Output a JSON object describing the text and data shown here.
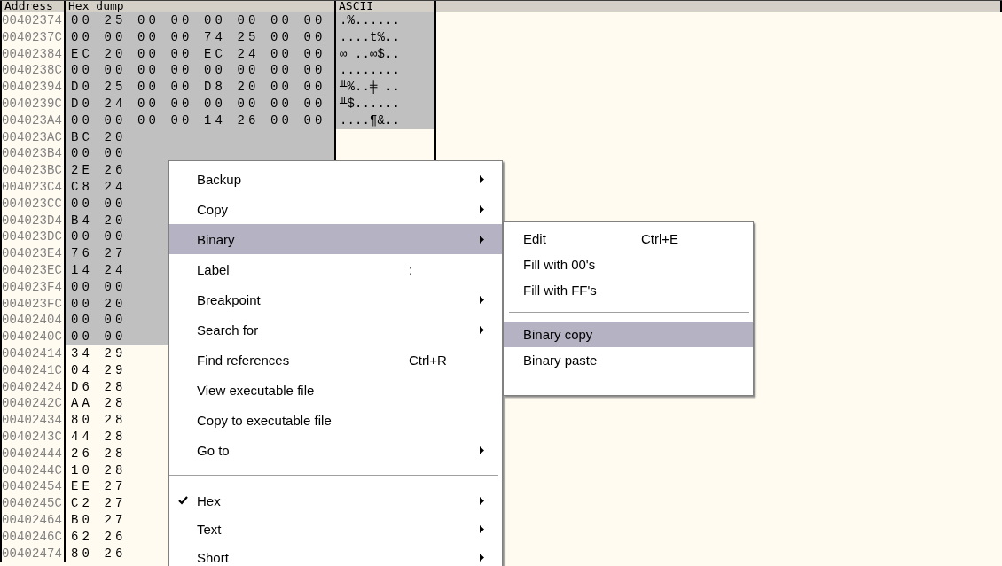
{
  "dump": {
    "columns": [
      "Address",
      "Hex dump",
      "ASCII"
    ],
    "rows": [
      {
        "address": "00402374",
        "hex": "00 25 00 00 00 00 00 00",
        "ascii": ".%......",
        "selected": true
      },
      {
        "address": "0040237C",
        "hex": "00 00 00 00 74 25 00 00",
        "ascii": "....t%..",
        "selected": true
      },
      {
        "address": "00402384",
        "hex": "EC 20 00 00 EC 24 00 00",
        "ascii": "∞ ..∞$..",
        "selected": true
      },
      {
        "address": "0040238C",
        "hex": "00 00 00 00 00 00 00 00",
        "ascii": "........",
        "selected": true
      },
      {
        "address": "00402394",
        "hex": "D0 25 00 00 D8 20 00 00",
        "ascii": "╨%..╪ ..",
        "selected": true
      },
      {
        "address": "0040239C",
        "hex": "D0 24 00 00 00 00 00 00",
        "ascii": "╨$......",
        "selected": true
      },
      {
        "address": "004023A4",
        "hex": "00 00 00 00 14 26 00 00",
        "ascii": "....¶&..",
        "selected": true
      },
      {
        "address": "004023AC",
        "hex": "BC 20",
        "selected": true
      },
      {
        "address": "004023B4",
        "hex": "00 00",
        "selected": true
      },
      {
        "address": "004023BC",
        "hex": "2E 26",
        "selected": true
      },
      {
        "address": "004023C4",
        "hex": "C8 24",
        "selected": true
      },
      {
        "address": "004023CC",
        "hex": "00 00",
        "selected": true
      },
      {
        "address": "004023D4",
        "hex": "B4 20",
        "selected": true
      },
      {
        "address": "004023DC",
        "hex": "00 00",
        "selected": true
      },
      {
        "address": "004023E4",
        "hex": "76 27",
        "selected": true
      },
      {
        "address": "004023EC",
        "hex": "14 24",
        "selected": true
      },
      {
        "address": "004023F4",
        "hex": "00 00",
        "selected": true
      },
      {
        "address": "004023FC",
        "hex": "00 20",
        "selected": true
      },
      {
        "address": "00402404",
        "hex": "00 00",
        "selected": true
      },
      {
        "address": "0040240C",
        "hex": "00 00",
        "selected": true
      },
      {
        "address": "00402414",
        "hex": "34 29",
        "selected": false
      },
      {
        "address": "0040241C",
        "hex": "04 29",
        "selected": false
      },
      {
        "address": "00402424",
        "hex": "D6 28",
        "selected": false
      },
      {
        "address": "0040242C",
        "hex": "AA 28",
        "selected": false
      },
      {
        "address": "00402434",
        "hex": "80 28",
        "selected": false
      },
      {
        "address": "0040243C",
        "hex": "44 28",
        "selected": false
      },
      {
        "address": "00402444",
        "hex": "26 28",
        "selected": false
      },
      {
        "address": "0040244C",
        "hex": "10 28",
        "selected": false
      },
      {
        "address": "00402454",
        "hex": "EE 27",
        "selected": false
      },
      {
        "address": "0040245C",
        "hex": "C2 27",
        "selected": false
      },
      {
        "address": "00402464",
        "hex": "B0 27",
        "selected": false
      },
      {
        "address": "0040246C",
        "hex": "62 26",
        "selected": false
      },
      {
        "address": "00402474",
        "hex": "80 26",
        "selected": false
      }
    ]
  },
  "context_menu": {
    "items": [
      {
        "kind": "item",
        "label": "Backup",
        "submenu": true,
        "selected": false
      },
      {
        "kind": "item",
        "label": "Copy",
        "submenu": true,
        "selected": false
      },
      {
        "kind": "item",
        "label": "Binary",
        "submenu": true,
        "selected": true
      },
      {
        "kind": "item",
        "label": "Label",
        "shortcut": ":",
        "selected": false
      },
      {
        "kind": "item",
        "label": "Breakpoint",
        "submenu": true,
        "selected": false
      },
      {
        "kind": "item",
        "label": "Search for",
        "submenu": true,
        "selected": false
      },
      {
        "kind": "item",
        "label": "Find references",
        "shortcut": "Ctrl+R",
        "selected": false
      },
      {
        "kind": "item",
        "label": "View executable file",
        "selected": false
      },
      {
        "kind": "item",
        "label": "Copy to executable file",
        "selected": false
      },
      {
        "kind": "item",
        "label": "Go to",
        "submenu": true,
        "selected": false
      },
      {
        "kind": "separator"
      },
      {
        "kind": "item",
        "label": "Hex",
        "submenu": true,
        "checked": true,
        "selected": false
      },
      {
        "kind": "item",
        "label": "Text",
        "submenu": true,
        "checked": false,
        "selected": false
      },
      {
        "kind": "item",
        "label": "Short",
        "submenu": true,
        "checked": false,
        "selected": false
      }
    ]
  },
  "submenu": {
    "items": [
      {
        "kind": "item",
        "label": "Edit",
        "shortcut": "Ctrl+E",
        "selected": false
      },
      {
        "kind": "item",
        "label": "Fill with 00's",
        "selected": false
      },
      {
        "kind": "item",
        "label": "Fill with FF's",
        "selected": false
      },
      {
        "kind": "separator"
      },
      {
        "kind": "item",
        "label": "Binary copy",
        "selected": true
      },
      {
        "kind": "item",
        "label": "Binary paste",
        "selected": false
      }
    ]
  }
}
